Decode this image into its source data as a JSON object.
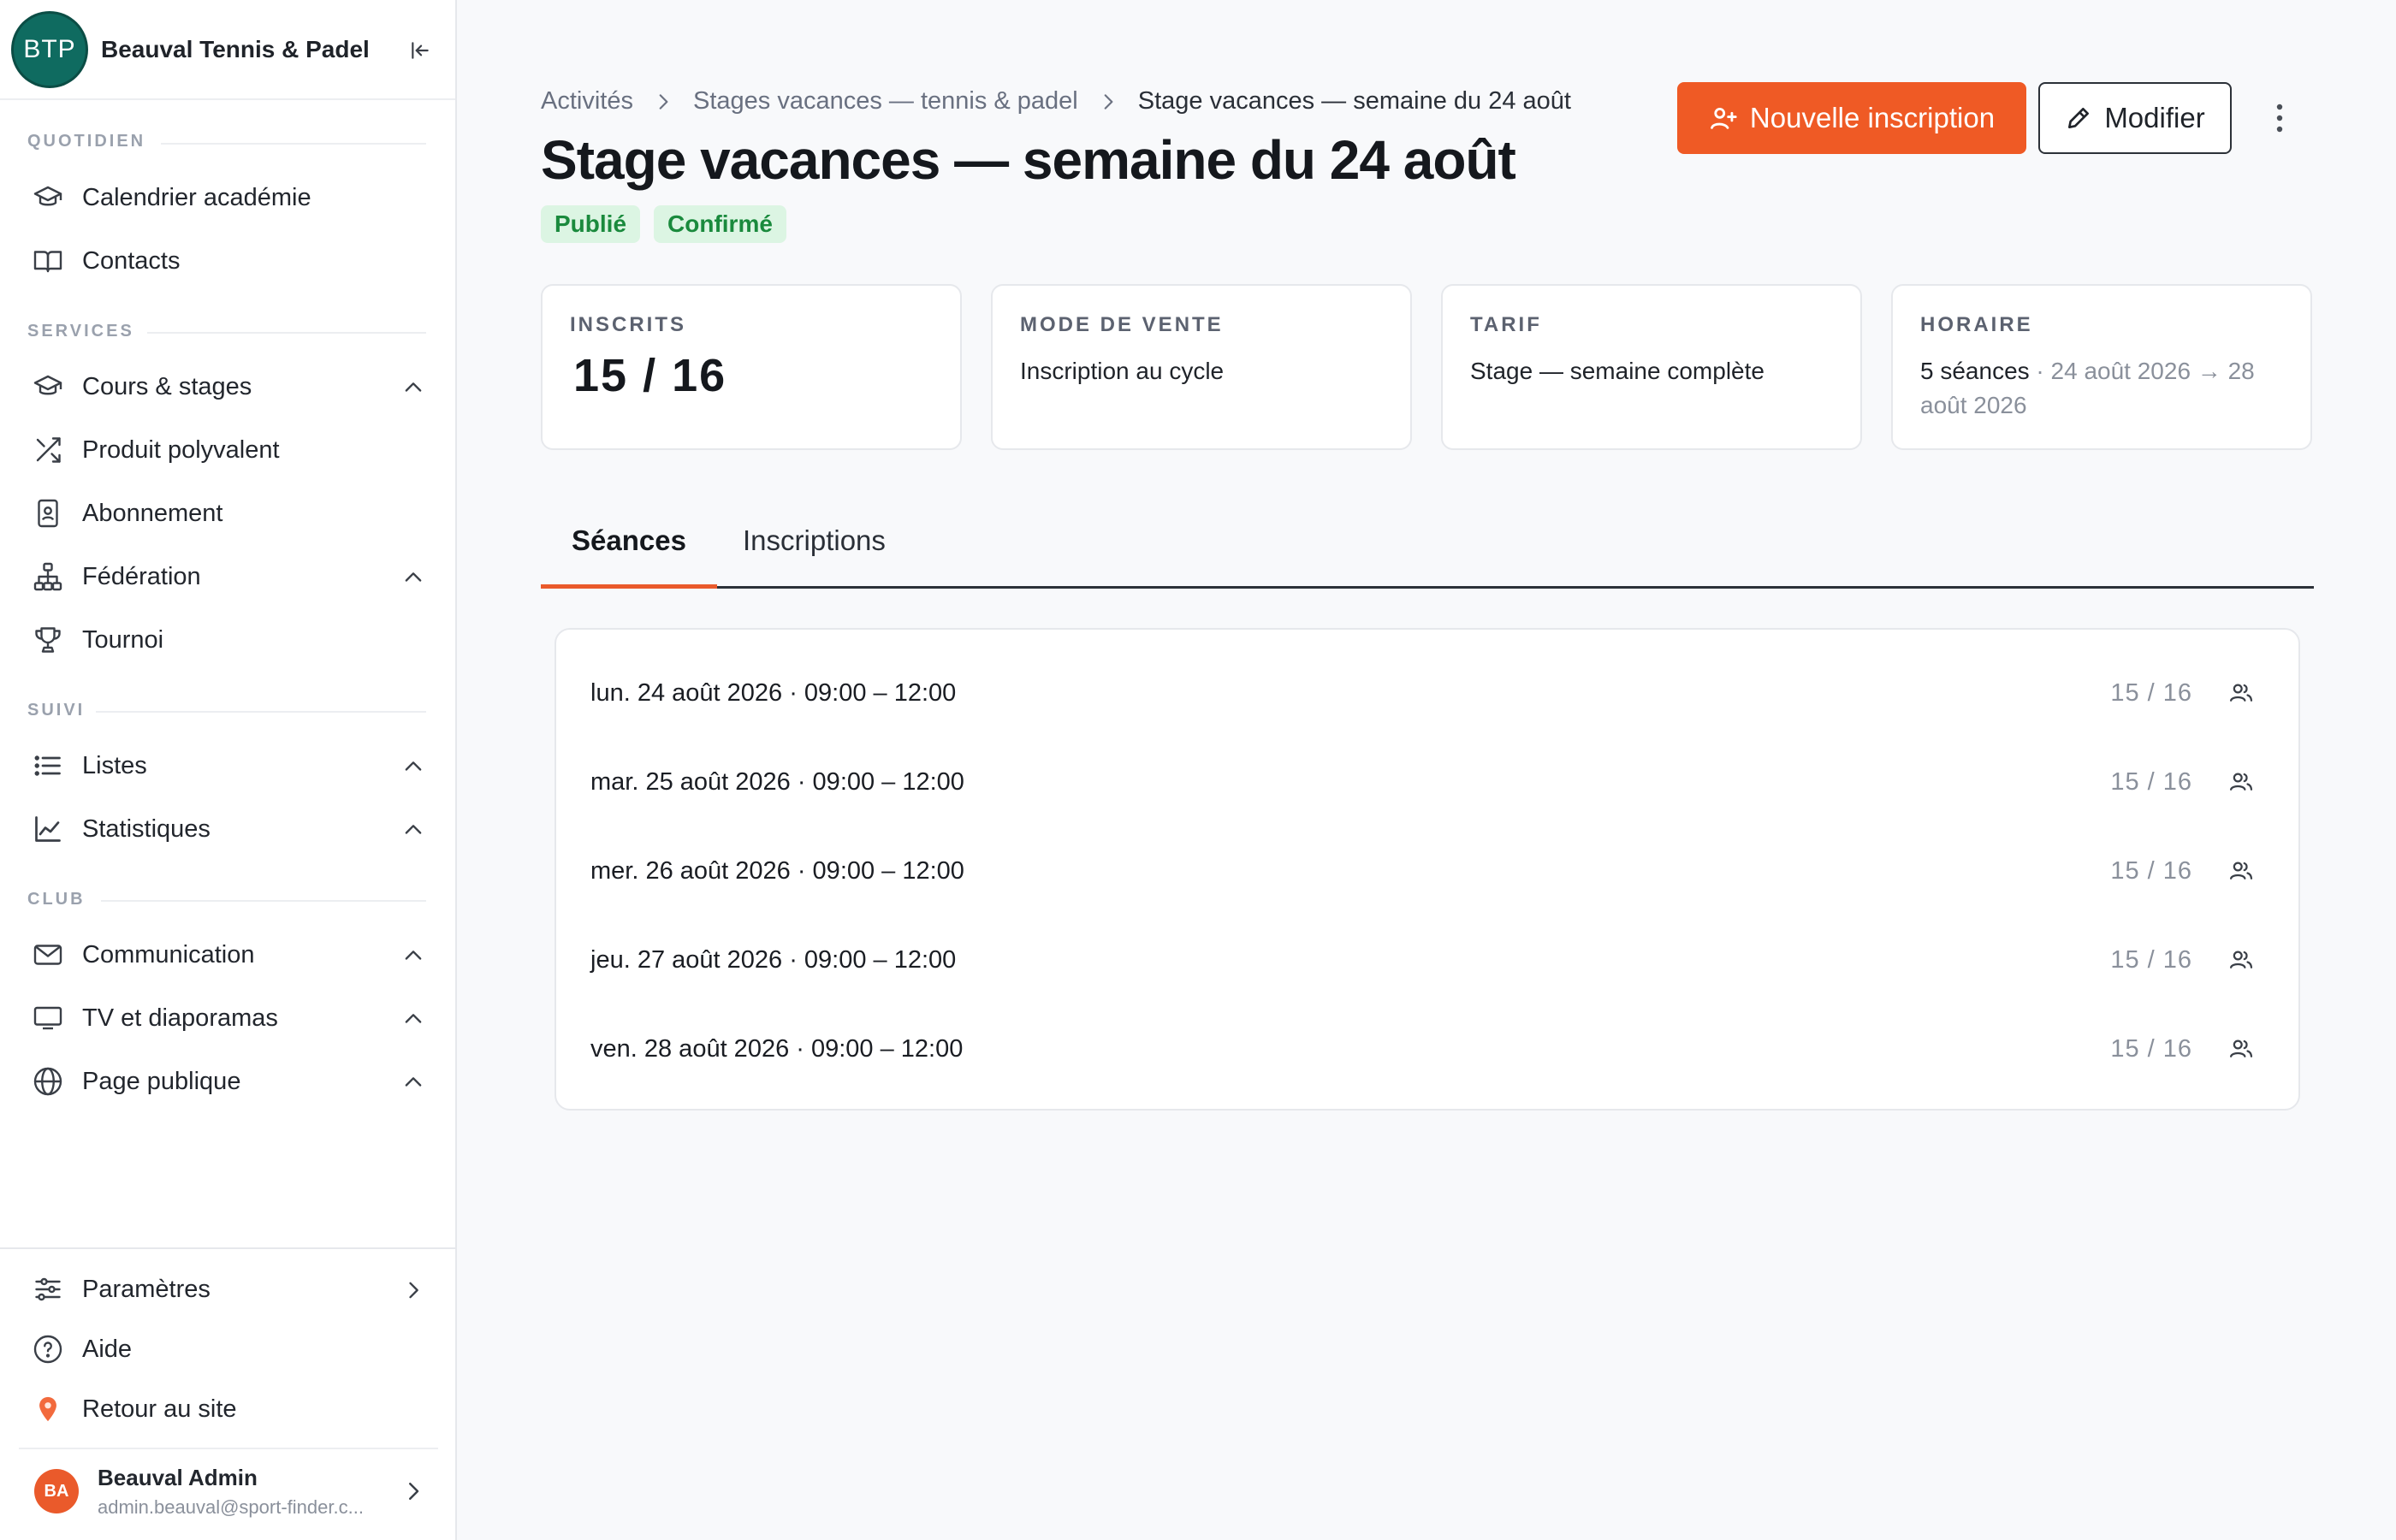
{
  "sidebar": {
    "logo_text": "BTP",
    "club_name": "Beauval Tennis & Padel",
    "sections": {
      "quotidien": "QUOTIDIEN",
      "services": "SERVICES",
      "suivi": "SUIVI",
      "club": "CLUB"
    },
    "items": {
      "calendrier": "Calendrier académie",
      "contacts": "Contacts",
      "cours": "Cours & stages",
      "produit": "Produit polyvalent",
      "abonnement": "Abonnement",
      "federation": "Fédération",
      "tournoi": "Tournoi",
      "listes": "Listes",
      "statistiques": "Statistiques",
      "communication": "Communication",
      "tv": "TV et diaporamas",
      "page_publique": "Page publique",
      "parametres": "Paramètres",
      "aide": "Aide",
      "retour": "Retour au site"
    },
    "user": {
      "initials": "BA",
      "name": "Beauval Admin",
      "email": "admin.beauval@sport-finder.c..."
    }
  },
  "breadcrumb": {
    "level1": "Activités",
    "level2": "Stages vacances — tennis & padel",
    "current": "Stage vacances — semaine du 24 août"
  },
  "page": {
    "title": "Stage vacances — semaine du 24 août",
    "badges": [
      "Publié",
      "Confirmé"
    ]
  },
  "actions": {
    "new_registration": "Nouvelle inscription",
    "edit": "Modifier"
  },
  "summary": {
    "inscrits": {
      "label": "INSCRITS",
      "value": "15 / 16"
    },
    "mode": {
      "label": "MODE DE VENTE",
      "value": "Inscription au cycle"
    },
    "tarif": {
      "label": "TARIF",
      "value": "Stage — semaine complète"
    },
    "horaire": {
      "label": "HORAIRE",
      "sessions": "5 séances",
      "range": "· 24 août 2026 → 28 août 2026"
    }
  },
  "tabs": [
    "Séances",
    "Inscriptions"
  ],
  "sessions": [
    {
      "when": "lun. 24 août 2026 · 09:00 – 12:00",
      "count": "15 / 16"
    },
    {
      "when": "mar. 25 août 2026 · 09:00 – 12:00",
      "count": "15 / 16"
    },
    {
      "when": "mer. 26 août 2026 · 09:00 – 12:00",
      "count": "15 / 16"
    },
    {
      "when": "jeu. 27 août 2026 · 09:00 – 12:00",
      "count": "15 / 16"
    },
    {
      "when": "ven. 28 août 2026 · 09:00 – 12:00",
      "count": "15 / 16"
    }
  ],
  "colors": {
    "accent": "#ef5a25",
    "brand": "#0f6b60",
    "status_green": "#1a8a3d",
    "status_green_bg": "#dcf5e3"
  }
}
